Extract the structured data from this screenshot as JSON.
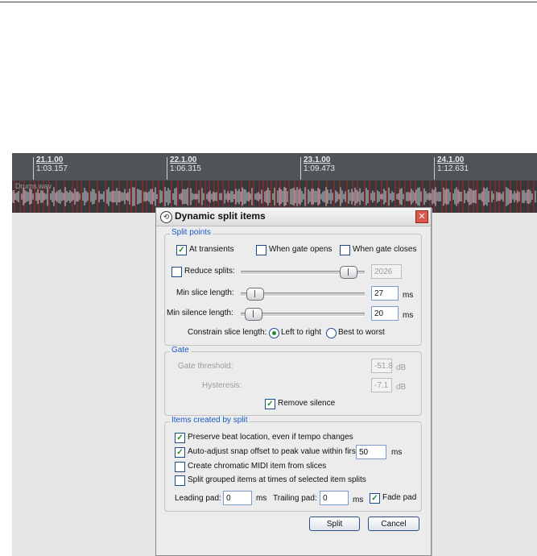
{
  "timeline": {
    "markers": [
      {
        "bar": "21.1.00",
        "time": "1:03.157"
      },
      {
        "bar": "22.1.00",
        "time": "1:06.315"
      },
      {
        "bar": "23.1.00",
        "time": "1:09.473"
      },
      {
        "bar": "24.1.00",
        "time": "1:12.631"
      }
    ],
    "track_name": "Drums.wav"
  },
  "dialog": {
    "title": "Dynamic split items",
    "split_points": {
      "legend": "Split points",
      "at_transients": "At transients",
      "when_gate_opens": "When gate opens",
      "when_gate_closes": "When gate closes",
      "reduce_splits_label": "Reduce splits:",
      "reduce_splits_value": "2026",
      "min_slice_label": "Min slice length:",
      "min_slice_value": "27",
      "min_silence_label": "Min silence length:",
      "min_silence_value": "20",
      "ms": "ms",
      "constrain_label": "Constrain slice length:",
      "left_to_right": "Left to right",
      "best_to_worst": "Best to worst"
    },
    "gate": {
      "legend": "Gate",
      "threshold_label": "Gate threshold:",
      "threshold_value": "-51.8",
      "hysteresis_label": "Hysteresis:",
      "hysteresis_value": "-7.1",
      "db": "dB",
      "remove_silence": "Remove silence"
    },
    "items": {
      "legend": "Items created by split",
      "preserve_beat": "Preserve beat location, even if tempo changes",
      "auto_adjust": "Auto-adjust snap offset to peak value within first:",
      "auto_adjust_value": "50",
      "ms": "ms",
      "chromatic_midi": "Create chromatic MIDI item from slices",
      "split_grouped": "Split grouped items at times of selected item splits",
      "leading_pad_label": "Leading pad:",
      "leading_pad_value": "0",
      "trailing_pad_label": "Trailing pad:",
      "trailing_pad_value": "0",
      "fade_pad": "Fade pad"
    },
    "buttons": {
      "split": "Split",
      "cancel": "Cancel"
    },
    "checked": {
      "at_transients": true,
      "when_gate_opens": false,
      "when_gate_closes": false,
      "reduce_splits": false,
      "remove_silence": true,
      "preserve_beat": true,
      "auto_adjust": true,
      "chromatic_midi": false,
      "split_grouped": false,
      "fade_pad": true
    },
    "slider_levels": {
      "reduce_splits": 0.92,
      "min_slice": 0.05,
      "min_silence": 0.04
    }
  },
  "colors": {
    "ruler_bg": "#4e5458",
    "track_bg": "#36393c",
    "waveform": "#c9d2da",
    "transient": "#b22222",
    "accent": "#1a5bc4"
  }
}
